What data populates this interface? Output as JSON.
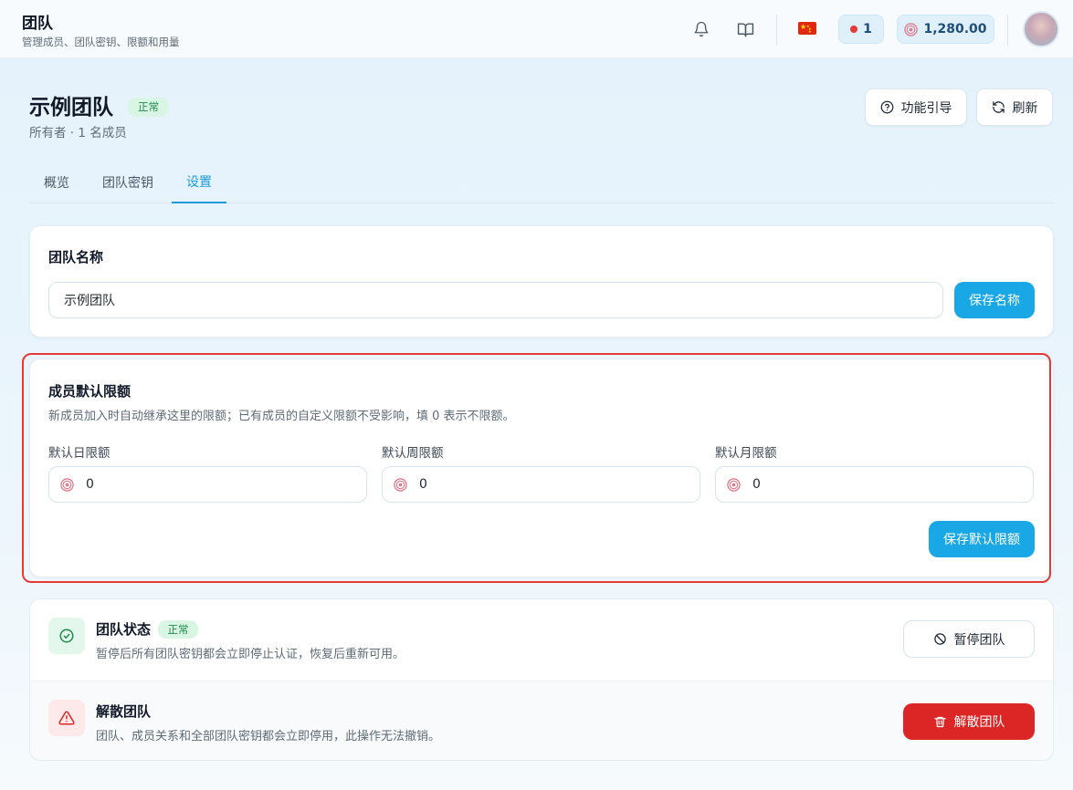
{
  "header": {
    "title": "团队",
    "subtitle": "管理成员、团队密钥、限额和用量",
    "notification_count": "1",
    "balance": "1,280.00"
  },
  "team": {
    "name": "示例团队",
    "status": "正常",
    "meta": "所有者 · 1 名成员",
    "guide_label": "功能引导",
    "refresh_label": "刷新"
  },
  "tabs": [
    {
      "label": "概览",
      "active": false
    },
    {
      "label": "团队密钥",
      "active": false
    },
    {
      "label": "设置",
      "active": true
    }
  ],
  "name_card": {
    "title": "团队名称",
    "value": "示例团队",
    "save_label": "保存名称"
  },
  "limits_card": {
    "title": "成员默认限额",
    "description": "新成员加入时自动继承这里的限额；已有成员的自定义限额不受影响，填 0 表示不限额。",
    "fields": [
      {
        "label": "默认日限额",
        "value": "0"
      },
      {
        "label": "默认周限额",
        "value": "0"
      },
      {
        "label": "默认月限额",
        "value": "0"
      }
    ],
    "save_label": "保存默认限额"
  },
  "status_card": {
    "title": "团队状态",
    "badge": "正常",
    "description": "暂停后所有团队密钥都会立即停止认证，恢复后重新可用。",
    "pause_label": "暂停团队"
  },
  "dissolve_card": {
    "title": "解散团队",
    "description": "团队、成员关系和全部团队密钥都会立即停用，此操作无法撤销。",
    "dissolve_label": "解散团队"
  },
  "colors": {
    "accent": "#1aa7e6",
    "success": "#1f8a4c",
    "danger": "#dc2626",
    "highlight": "#e53935"
  },
  "icons": [
    "bell-icon",
    "book-icon",
    "china-flag-icon",
    "coin-icon",
    "help-circle-icon",
    "refresh-icon",
    "check-circle-icon",
    "ban-icon",
    "warning-icon",
    "trash-icon"
  ]
}
